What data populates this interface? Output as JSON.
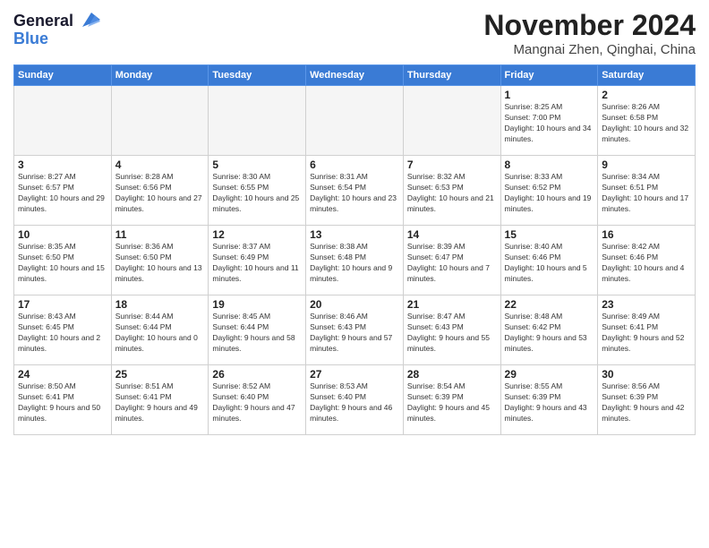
{
  "logo": {
    "line1": "General",
    "line2": "Blue"
  },
  "title": "November 2024",
  "location": "Mangnai Zhen, Qinghai, China",
  "days_of_week": [
    "Sunday",
    "Monday",
    "Tuesday",
    "Wednesday",
    "Thursday",
    "Friday",
    "Saturday"
  ],
  "weeks": [
    [
      {
        "day": "",
        "empty": true
      },
      {
        "day": "",
        "empty": true
      },
      {
        "day": "",
        "empty": true
      },
      {
        "day": "",
        "empty": true
      },
      {
        "day": "",
        "empty": true
      },
      {
        "day": "1",
        "sunrise": "8:25 AM",
        "sunset": "7:00 PM",
        "daylight": "10 hours and 34 minutes."
      },
      {
        "day": "2",
        "sunrise": "8:26 AM",
        "sunset": "6:58 PM",
        "daylight": "10 hours and 32 minutes."
      }
    ],
    [
      {
        "day": "3",
        "sunrise": "8:27 AM",
        "sunset": "6:57 PM",
        "daylight": "10 hours and 29 minutes."
      },
      {
        "day": "4",
        "sunrise": "8:28 AM",
        "sunset": "6:56 PM",
        "daylight": "10 hours and 27 minutes."
      },
      {
        "day": "5",
        "sunrise": "8:30 AM",
        "sunset": "6:55 PM",
        "daylight": "10 hours and 25 minutes."
      },
      {
        "day": "6",
        "sunrise": "8:31 AM",
        "sunset": "6:54 PM",
        "daylight": "10 hours and 23 minutes."
      },
      {
        "day": "7",
        "sunrise": "8:32 AM",
        "sunset": "6:53 PM",
        "daylight": "10 hours and 21 minutes."
      },
      {
        "day": "8",
        "sunrise": "8:33 AM",
        "sunset": "6:52 PM",
        "daylight": "10 hours and 19 minutes."
      },
      {
        "day": "9",
        "sunrise": "8:34 AM",
        "sunset": "6:51 PM",
        "daylight": "10 hours and 17 minutes."
      }
    ],
    [
      {
        "day": "10",
        "sunrise": "8:35 AM",
        "sunset": "6:50 PM",
        "daylight": "10 hours and 15 minutes."
      },
      {
        "day": "11",
        "sunrise": "8:36 AM",
        "sunset": "6:50 PM",
        "daylight": "10 hours and 13 minutes."
      },
      {
        "day": "12",
        "sunrise": "8:37 AM",
        "sunset": "6:49 PM",
        "daylight": "10 hours and 11 minutes."
      },
      {
        "day": "13",
        "sunrise": "8:38 AM",
        "sunset": "6:48 PM",
        "daylight": "10 hours and 9 minutes."
      },
      {
        "day": "14",
        "sunrise": "8:39 AM",
        "sunset": "6:47 PM",
        "daylight": "10 hours and 7 minutes."
      },
      {
        "day": "15",
        "sunrise": "8:40 AM",
        "sunset": "6:46 PM",
        "daylight": "10 hours and 5 minutes."
      },
      {
        "day": "16",
        "sunrise": "8:42 AM",
        "sunset": "6:46 PM",
        "daylight": "10 hours and 4 minutes."
      }
    ],
    [
      {
        "day": "17",
        "sunrise": "8:43 AM",
        "sunset": "6:45 PM",
        "daylight": "10 hours and 2 minutes."
      },
      {
        "day": "18",
        "sunrise": "8:44 AM",
        "sunset": "6:44 PM",
        "daylight": "10 hours and 0 minutes."
      },
      {
        "day": "19",
        "sunrise": "8:45 AM",
        "sunset": "6:44 PM",
        "daylight": "9 hours and 58 minutes."
      },
      {
        "day": "20",
        "sunrise": "8:46 AM",
        "sunset": "6:43 PM",
        "daylight": "9 hours and 57 minutes."
      },
      {
        "day": "21",
        "sunrise": "8:47 AM",
        "sunset": "6:43 PM",
        "daylight": "9 hours and 55 minutes."
      },
      {
        "day": "22",
        "sunrise": "8:48 AM",
        "sunset": "6:42 PM",
        "daylight": "9 hours and 53 minutes."
      },
      {
        "day": "23",
        "sunrise": "8:49 AM",
        "sunset": "6:41 PM",
        "daylight": "9 hours and 52 minutes."
      }
    ],
    [
      {
        "day": "24",
        "sunrise": "8:50 AM",
        "sunset": "6:41 PM",
        "daylight": "9 hours and 50 minutes."
      },
      {
        "day": "25",
        "sunrise": "8:51 AM",
        "sunset": "6:41 PM",
        "daylight": "9 hours and 49 minutes."
      },
      {
        "day": "26",
        "sunrise": "8:52 AM",
        "sunset": "6:40 PM",
        "daylight": "9 hours and 47 minutes."
      },
      {
        "day": "27",
        "sunrise": "8:53 AM",
        "sunset": "6:40 PM",
        "daylight": "9 hours and 46 minutes."
      },
      {
        "day": "28",
        "sunrise": "8:54 AM",
        "sunset": "6:39 PM",
        "daylight": "9 hours and 45 minutes."
      },
      {
        "day": "29",
        "sunrise": "8:55 AM",
        "sunset": "6:39 PM",
        "daylight": "9 hours and 43 minutes."
      },
      {
        "day": "30",
        "sunrise": "8:56 AM",
        "sunset": "6:39 PM",
        "daylight": "9 hours and 42 minutes."
      }
    ]
  ]
}
